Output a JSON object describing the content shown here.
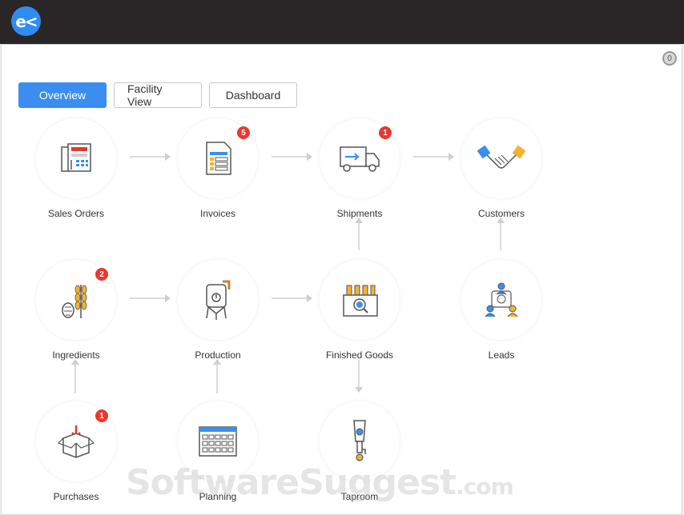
{
  "app": {
    "logo_text": "e<"
  },
  "notifications": {
    "count": "0"
  },
  "tabs": [
    {
      "label": "Overview",
      "active": true
    },
    {
      "label": "Facility View",
      "active": false
    },
    {
      "label": "Dashboard",
      "active": false
    }
  ],
  "nodes": {
    "sales_orders": {
      "label": "Sales Orders",
      "icon": "fax-receipt-icon"
    },
    "invoices": {
      "label": "Invoices",
      "badge": "5",
      "icon": "invoice-icon"
    },
    "shipments": {
      "label": "Shipments",
      "badge": "1",
      "icon": "delivery-truck-icon"
    },
    "customers": {
      "label": "Customers",
      "icon": "handshake-icon"
    },
    "ingredients": {
      "label": "Ingredients",
      "badge": "2",
      "icon": "wheat-hops-icon"
    },
    "production": {
      "label": "Production",
      "icon": "fermenter-tank-icon"
    },
    "finished_goods": {
      "label": "Finished Goods",
      "icon": "bottle-crate-icon"
    },
    "leads": {
      "label": "Leads",
      "icon": "network-people-icon"
    },
    "purchases": {
      "label": "Purchases",
      "badge": "1",
      "icon": "open-box-icon"
    },
    "planning": {
      "label": "Planning",
      "icon": "calendar-icon"
    },
    "taproom": {
      "label": "Taproom",
      "icon": "beer-tap-icon"
    }
  },
  "watermark": {
    "main": "SoftwareSuggest",
    "suffix": ".com"
  },
  "colors": {
    "accent": "#3b8ef0",
    "badge": "#e8392f",
    "topbar": "#2a2526"
  }
}
